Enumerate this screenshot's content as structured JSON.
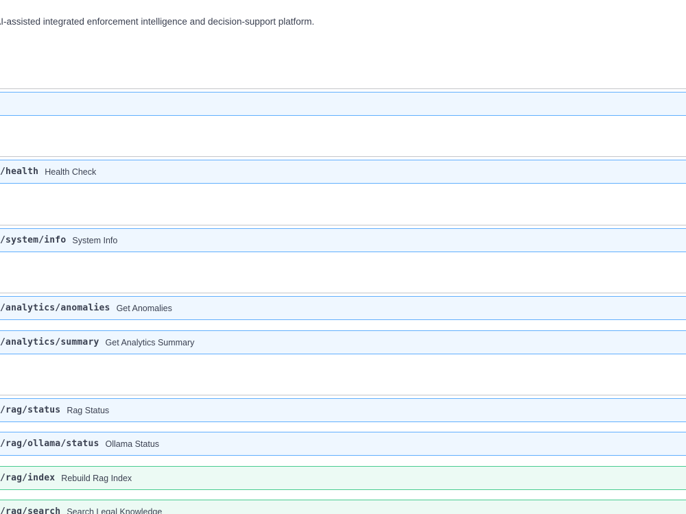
{
  "info": {
    "description": "ti, an AI-assisted integrated enforcement intelligence and decision-support platform."
  },
  "operations": {
    "unnamed": {
      "method": "get",
      "path": "",
      "summary": ""
    },
    "health": {
      "method": "get",
      "path": "i/health",
      "summary": "Health Check"
    },
    "system_info": {
      "method": "get",
      "path": "i/system/info",
      "summary": "System Info"
    },
    "anomalies": {
      "method": "get",
      "path": "i/analytics/anomalies",
      "summary": "Get Anomalies"
    },
    "analytics_summary": {
      "method": "get",
      "path": "i/analytics/summary",
      "summary": "Get Analytics Summary"
    },
    "rag_status": {
      "method": "get",
      "path": "i/rag/status",
      "summary": "Rag Status"
    },
    "ollama_status": {
      "method": "get",
      "path": "i/rag/ollama/status",
      "summary": "Ollama Status"
    },
    "rag_index": {
      "method": "post",
      "path": "i/rag/index",
      "summary": "Rebuild Rag Index"
    },
    "rag_search": {
      "method": "post",
      "path": "i/rag/search",
      "summary": "Search Legal Knowledge"
    }
  },
  "colors": {
    "get_border": "#61affe",
    "get_background": "#eff7ff",
    "post_border": "#49cc90",
    "post_background": "#edfaf4",
    "text": "#3b4151"
  }
}
